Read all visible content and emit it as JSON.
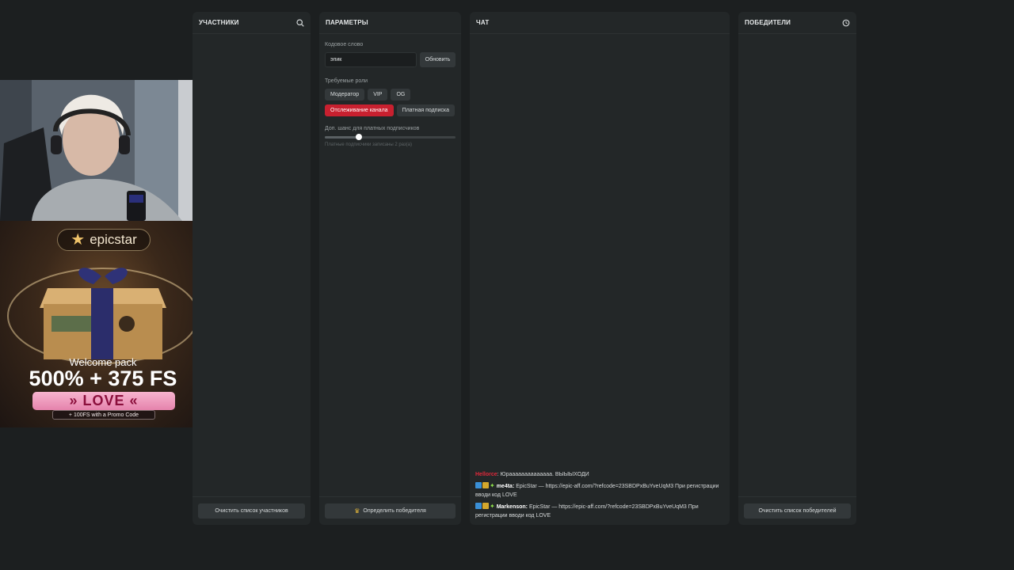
{
  "participants": {
    "title": "УЧАСТНИКИ",
    "search_icon": "search-icon",
    "clear_button": "Очистить список участников"
  },
  "params": {
    "title": "ПАРАМЕТРЫ",
    "codeword_label": "Кодовое слово",
    "codeword_value": "эпик",
    "update_button": "Обновить",
    "roles_label": "Требуемые роли",
    "roles": [
      "Модератор",
      "VIP",
      "OG"
    ],
    "roles2": [
      {
        "label": "Отслеживание канала",
        "active": true
      },
      {
        "label": "Платная подписка",
        "active": false
      }
    ],
    "bonus_label": "Доп. шанс для платных подписчиков",
    "bonus_slider_fraction": 0.26,
    "bonus_hint": "Платные подписчики записаны 2 раз(а)",
    "pick_winner_button": "Определить победителя",
    "crown_icon": "crown-icon"
  },
  "chat": {
    "title": "ЧАТ",
    "messages": [
      {
        "user": "Hellorce",
        "user_color": "#e0283a",
        "text": ": Юраааааааааааааа. ВЫЫЫХОДИ",
        "badges": false
      },
      {
        "user": "me4ta:",
        "text": " EpicStar — https://epic-aff.com/?refcode=23SBDPxBuYveUqM3 При регистрации вводи код LOVE",
        "badges": true
      },
      {
        "user": "Markenson:",
        "text": " EpicStar — https://epic-aff.com/?refcode=23SBDPxBuYveUqM3 При регистрации вводи код LOVE",
        "badges": true
      }
    ]
  },
  "winners": {
    "title": "ПОБЕДИТЕЛИ",
    "history_icon": "history-icon",
    "clear_button": "Очистить список победителей"
  },
  "ad": {
    "brand": "epicstar",
    "welcome": "Welcome pack",
    "offer": "500% + 375 FS",
    "code": "» LOVE «",
    "promo": "+ 100FS with a Promo Code"
  },
  "colors": {
    "accent_red": "#c8202f",
    "panel_bg": "#232728",
    "page_bg": "#1c1f20"
  }
}
